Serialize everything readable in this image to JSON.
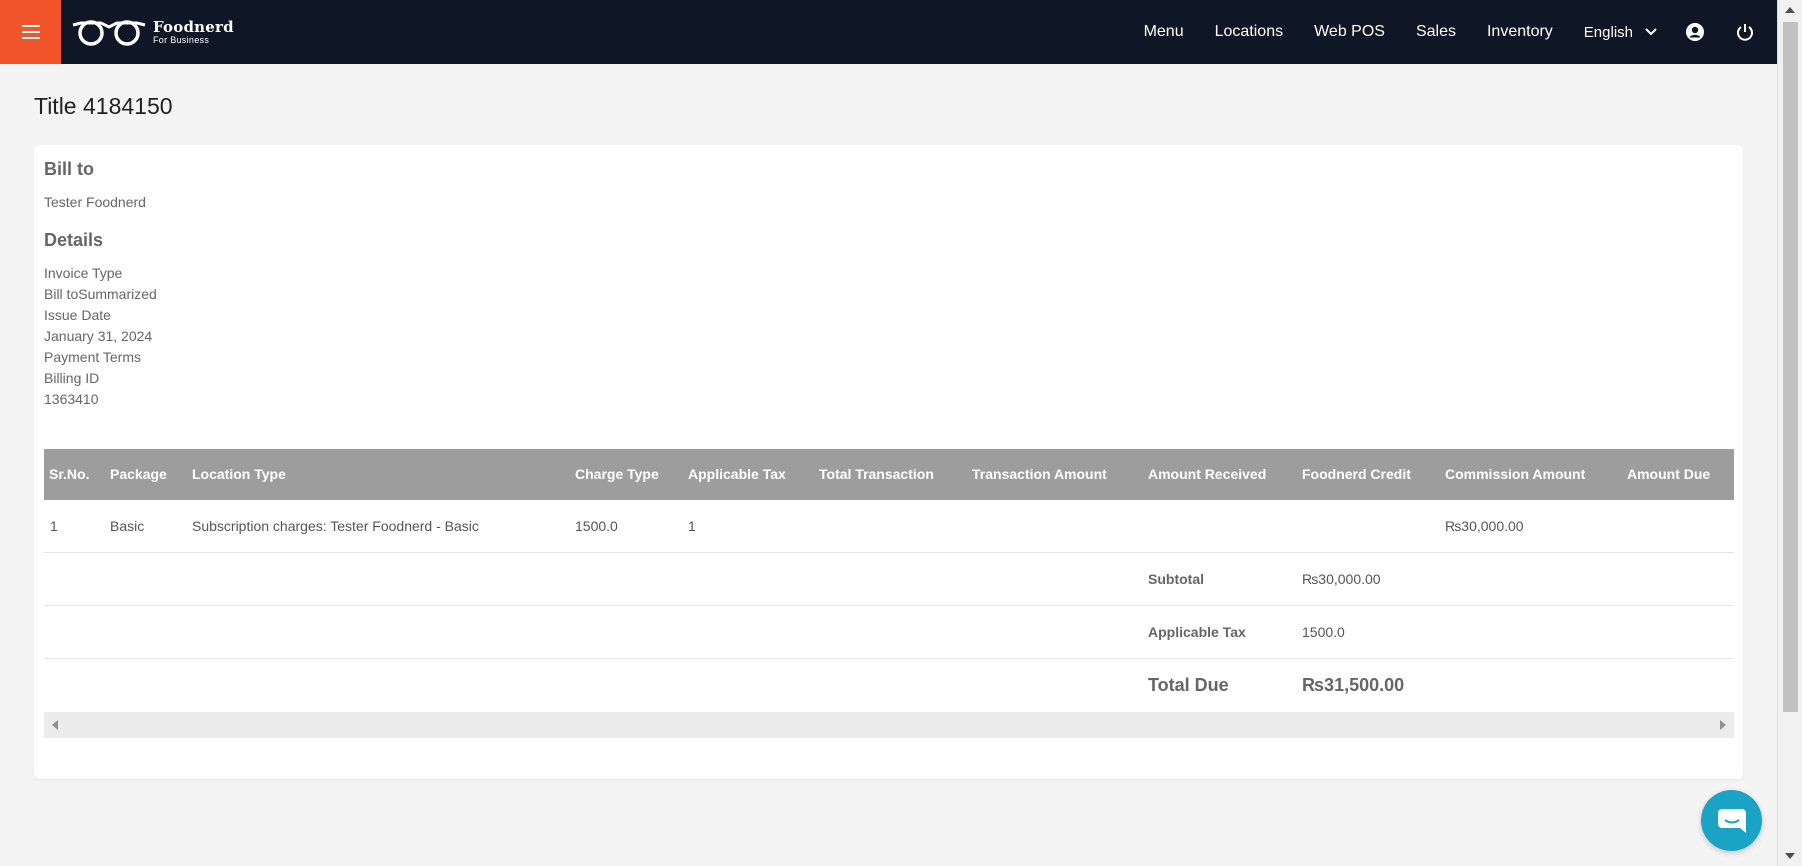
{
  "brand": {
    "name": "Foodnerd",
    "tagline": "For Business"
  },
  "nav": {
    "links": [
      "Menu",
      "Locations",
      "Web POS",
      "Sales",
      "Inventory"
    ],
    "language": "English"
  },
  "page": {
    "title": "Title 4184150"
  },
  "bill_to": {
    "heading": "Bill to",
    "name": "Tester Foodnerd"
  },
  "details": {
    "heading": "Details",
    "lines": [
      "Invoice Type",
      "Bill toSummarized",
      "Issue Date",
      "January 31, 2024",
      "Payment Terms",
      "Billing ID",
      "1363410"
    ]
  },
  "table": {
    "headers": [
      "Sr.No.",
      "Package",
      "Location Type",
      "Charge Type",
      "Applicable Tax",
      "Total Transaction",
      "Transaction Amount",
      "Amount Received",
      "Foodnerd Credit",
      "Commission Amount",
      "Amount Due"
    ],
    "rows": [
      {
        "sr": "1",
        "package": "Basic",
        "location_type": "Subscription charges: Tester Foodnerd - Basic",
        "charge_type": "1500.0",
        "applicable_tax": "1",
        "total_transaction": "",
        "transaction_amount": "",
        "amount_received": "",
        "foodnerd_credit": "",
        "commission_amount": "₨30,000.00",
        "amount_due": ""
      }
    ]
  },
  "summary": {
    "subtotal_label": "Subtotal",
    "subtotal_value": "₨30,000.00",
    "tax_label": "Applicable Tax",
    "tax_value": "1500.0",
    "total_label": "Total Due",
    "total_value": "₨31,500.00"
  },
  "icons": {
    "menu": "hamburger-icon",
    "language_toggle": "chevron-down-icon",
    "account": "user-circle-icon",
    "logout": "power-icon",
    "chat": "chat-bubble-icon"
  },
  "colors": {
    "navbar": "#0f1625",
    "accent": "#f2552c",
    "table_header": "#9d9d9d",
    "chat": "#1aa3c4"
  }
}
